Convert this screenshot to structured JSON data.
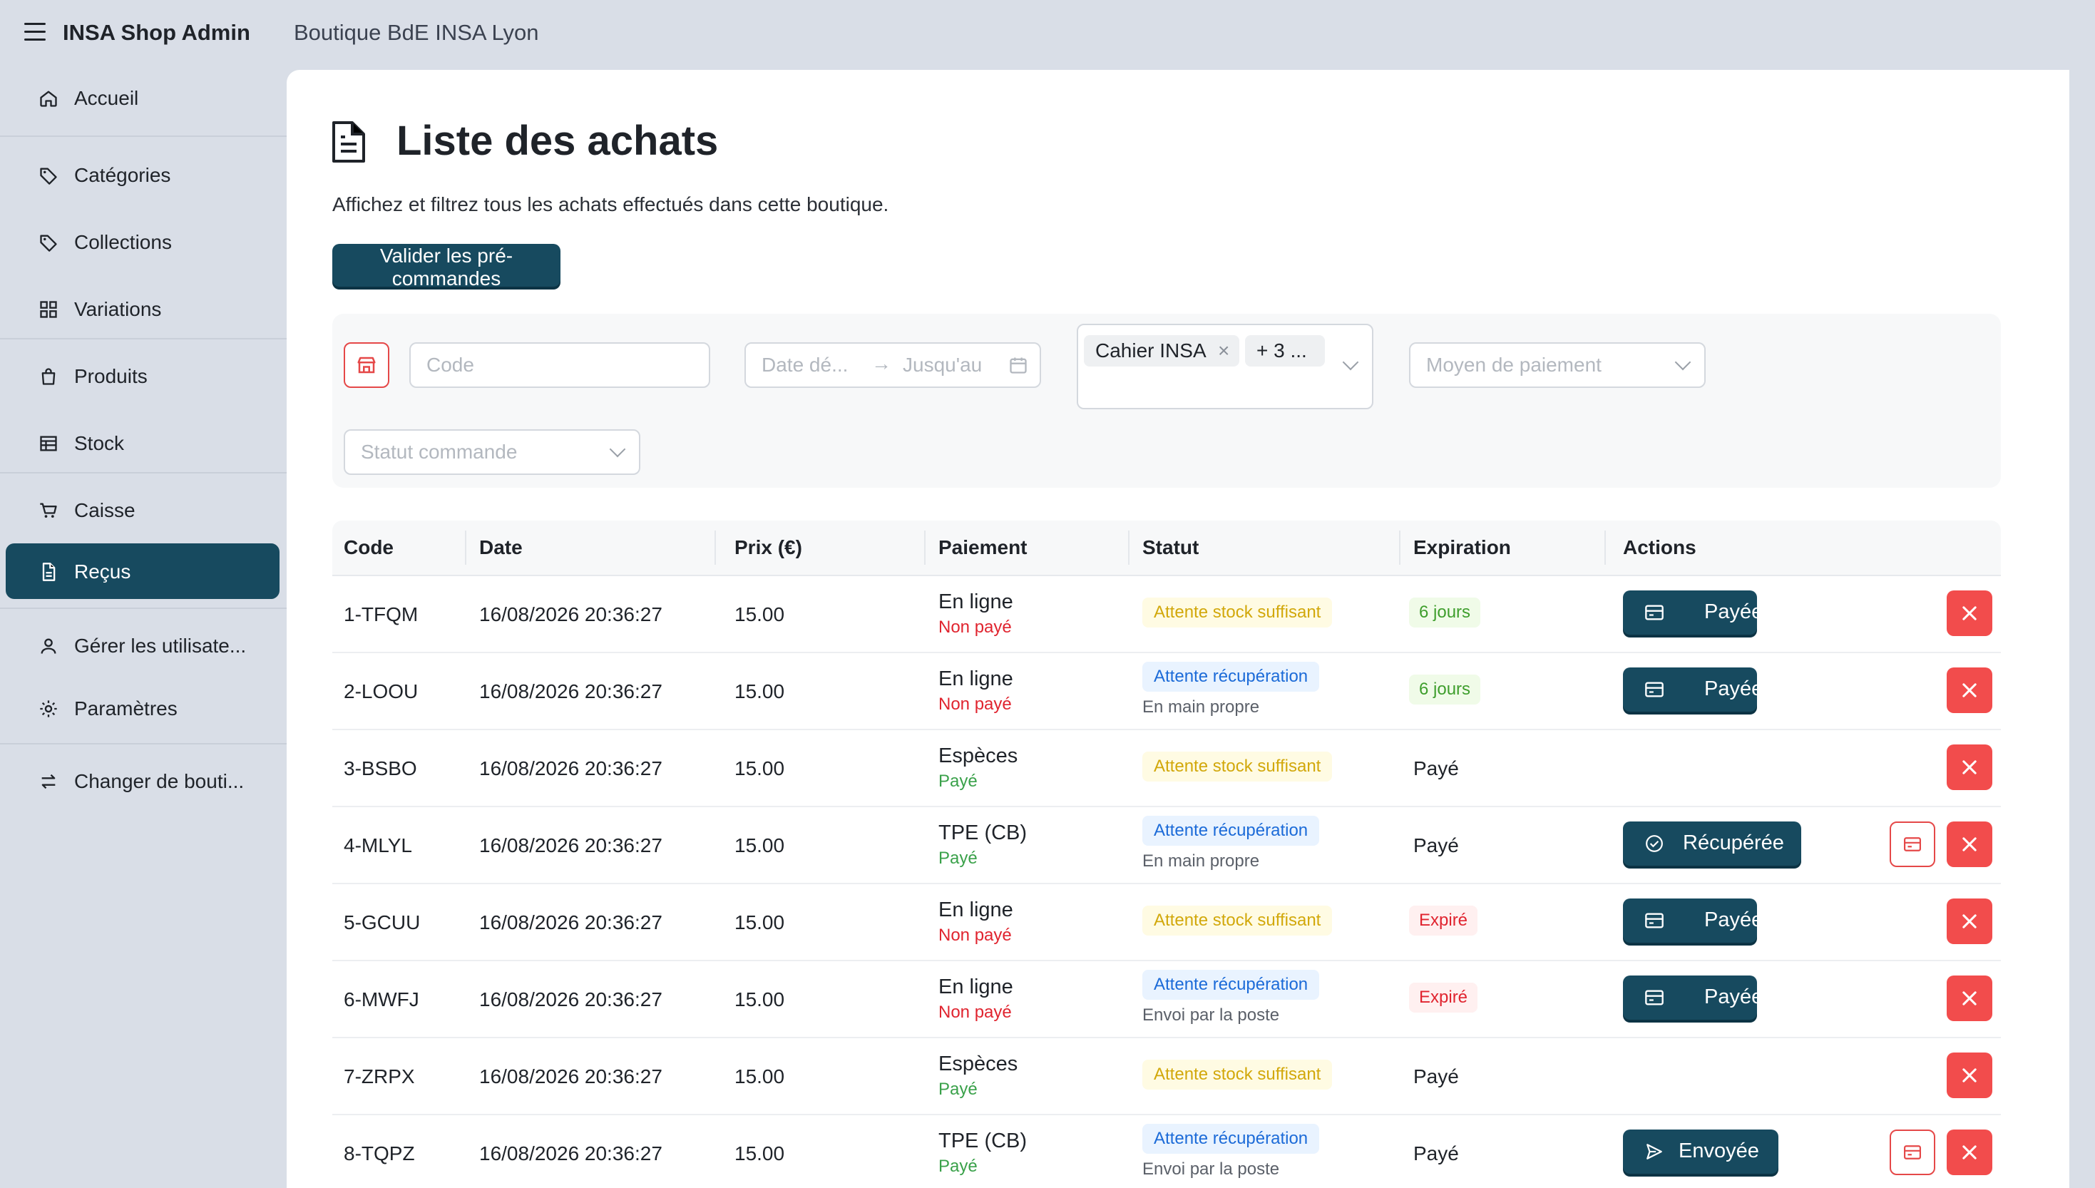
{
  "header": {
    "app_title": "INSA Shop Admin",
    "shop_name": "Boutique BdE INSA Lyon"
  },
  "sidebar": {
    "items": [
      {
        "label": "Accueil",
        "icon": "home-icon"
      },
      {
        "label": "Catégories",
        "icon": "tag-icon"
      },
      {
        "label": "Collections",
        "icon": "tags-icon"
      },
      {
        "label": "Variations",
        "icon": "grid-icon"
      },
      {
        "label": "Produits",
        "icon": "shopping-bag-icon"
      },
      {
        "label": "Stock",
        "icon": "warehouse-icon"
      },
      {
        "label": "Caisse",
        "icon": "cart-icon"
      },
      {
        "label": "Reçus",
        "icon": "file-icon",
        "active": true
      },
      {
        "label": "Gérer les utilisate...",
        "icon": "user-icon"
      },
      {
        "label": "Paramètres",
        "icon": "gear-icon"
      },
      {
        "label": "Changer de bouti...",
        "icon": "swap-icon"
      }
    ]
  },
  "page": {
    "title": "Liste des achats",
    "subtitle": "Affichez et filtrez tous les achats effectués dans cette boutique.",
    "validate_button": "Valider les pré-commandes"
  },
  "filters": {
    "code_placeholder": "Code",
    "date_start_placeholder": "Date dé...",
    "date_end_placeholder": "Jusqu'au",
    "product_chip": "Cahier INSA",
    "product_more_chip": "+ 3 ...",
    "payment_placeholder": "Moyen de paiement",
    "status_placeholder": "Statut commande"
  },
  "table": {
    "headers": [
      "Code",
      "Date",
      "Prix (€)",
      "Paiement",
      "Statut",
      "Expiration",
      "Actions"
    ],
    "rows": [
      {
        "code": "1-TFQM",
        "date": "16/08/2026 20:36:27",
        "price": "15.00",
        "payment": "En ligne",
        "payment_state": "Non payé",
        "paid": false,
        "status": "Attente stock suffisant",
        "status_color": "yellow",
        "status_sub": "",
        "expiration": "6 jours",
        "exp_style": "green",
        "action": "Payée",
        "action_icon": "card",
        "card_button": false
      },
      {
        "code": "2-LOOU",
        "date": "16/08/2026 20:36:27",
        "price": "15.00",
        "payment": "En ligne",
        "payment_state": "Non payé",
        "paid": false,
        "status": "Attente récupération",
        "status_color": "blue",
        "status_sub": "En main propre",
        "expiration": "6 jours",
        "exp_style": "green",
        "action": "Payée",
        "action_icon": "card",
        "card_button": false
      },
      {
        "code": "3-BSBO",
        "date": "16/08/2026 20:36:27",
        "price": "15.00",
        "payment": "Espèces",
        "payment_state": "Payé",
        "paid": true,
        "status": "Attente stock suffisant",
        "status_color": "yellow",
        "status_sub": "",
        "expiration": "Payé",
        "exp_style": "plain",
        "action": "",
        "action_icon": "",
        "card_button": false
      },
      {
        "code": "4-MLYL",
        "date": "16/08/2026 20:36:27",
        "price": "15.00",
        "payment": "TPE (CB)",
        "payment_state": "Payé",
        "paid": true,
        "status": "Attente récupération",
        "status_color": "blue",
        "status_sub": "En main propre",
        "expiration": "Payé",
        "exp_style": "plain",
        "action": "Récupérée",
        "action_icon": "check",
        "card_button": true
      },
      {
        "code": "5-GCUU",
        "date": "16/08/2026 20:36:27",
        "price": "15.00",
        "payment": "En ligne",
        "payment_state": "Non payé",
        "paid": false,
        "status": "Attente stock suffisant",
        "status_color": "yellow",
        "status_sub": "",
        "expiration": "Expiré",
        "exp_style": "red",
        "action": "Payée",
        "action_icon": "card",
        "card_button": false
      },
      {
        "code": "6-MWFJ",
        "date": "16/08/2026 20:36:27",
        "price": "15.00",
        "payment": "En ligne",
        "payment_state": "Non payé",
        "paid": false,
        "status": "Attente récupération",
        "status_color": "blue",
        "status_sub": "Envoi par la poste",
        "expiration": "Expiré",
        "exp_style": "red",
        "action": "Payée",
        "action_icon": "card",
        "card_button": false
      },
      {
        "code": "7-ZRPX",
        "date": "16/08/2026 20:36:27",
        "price": "15.00",
        "payment": "Espèces",
        "payment_state": "Payé",
        "paid": true,
        "status": "Attente stock suffisant",
        "status_color": "yellow",
        "status_sub": "",
        "expiration": "Payé",
        "exp_style": "plain",
        "action": "",
        "action_icon": "",
        "card_button": false
      },
      {
        "code": "8-TQPZ",
        "date": "16/08/2026 20:36:27",
        "price": "15.00",
        "payment": "TPE (CB)",
        "payment_state": "Payé",
        "paid": true,
        "status": "Attente récupération",
        "status_color": "blue",
        "status_sub": "Envoi par la poste",
        "expiration": "Payé",
        "exp_style": "plain",
        "action": "Envoyée",
        "action_icon": "send",
        "card_button": true
      }
    ]
  },
  "colors": {
    "primary": "#174a5f",
    "danger": "#f24c4c",
    "sidebar_bg": "#d9dee7"
  }
}
